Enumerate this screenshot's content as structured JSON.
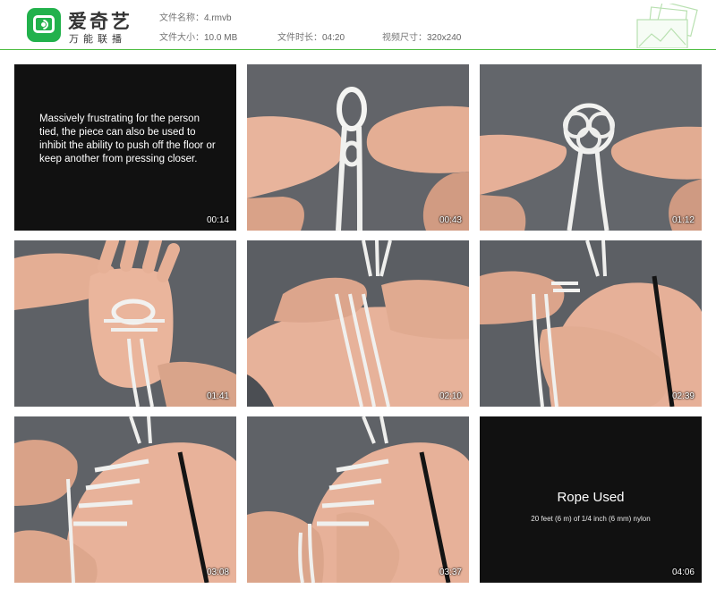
{
  "header": {
    "brand_name": "爱奇艺",
    "brand_sub": "万能联播",
    "file_name_label": "文件名称：",
    "file_name": "4.rmvb",
    "file_size_label": "文件大小：",
    "file_size": "10.0 MB",
    "duration_label": "文件时长：",
    "duration": "04:20",
    "dimensions_label": "视频尺寸：",
    "dimensions": "320x240"
  },
  "colors": {
    "brand_green": "#22b14c",
    "divider": "#4cbc3f"
  },
  "thumbnails": [
    {
      "time": "00:14",
      "kind": "text",
      "caption": "Massively frustrating for the person tied, the piece can also be used to inhibit the ability to push off the floor or keep another from pressing closer."
    },
    {
      "time": "00:43",
      "kind": "image",
      "scene": "hands forming rope loop"
    },
    {
      "time": "01:12",
      "kind": "image",
      "scene": "hands holding decorative knot"
    },
    {
      "time": "01:41",
      "kind": "image",
      "scene": "knot placed on back of hand"
    },
    {
      "time": "02:10",
      "kind": "image",
      "scene": "rope wrapped around arm"
    },
    {
      "time": "02:39",
      "kind": "image",
      "scene": "rope cuff tightened on arm"
    },
    {
      "time": "03:08",
      "kind": "image",
      "scene": "wraps along forearm"
    },
    {
      "time": "03:37",
      "kind": "image",
      "scene": "finished wraps on arm"
    },
    {
      "time": "04:06",
      "kind": "text",
      "title": "Rope Used",
      "desc": "20 feet (6 m) of 1/4 inch (6 mm) nylon"
    }
  ]
}
